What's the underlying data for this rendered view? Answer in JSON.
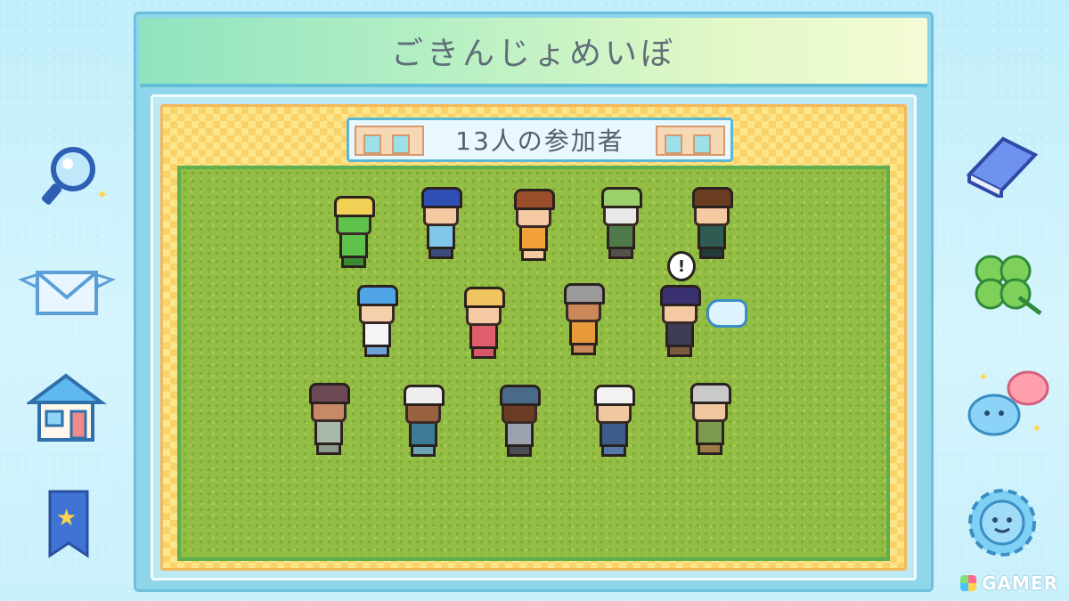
{
  "title": "ごきんじょめいぼ",
  "banner": {
    "label": "13人の参加者"
  },
  "left_menu": [
    {
      "icon": "magnifier-icon"
    },
    {
      "icon": "winged-envelope-icon"
    },
    {
      "icon": "house-icon"
    },
    {
      "icon": "star-bookmark-icon"
    }
  ],
  "right_menu": [
    {
      "icon": "book-icon"
    },
    {
      "icon": "clover-icon"
    },
    {
      "icon": "slime-faces-icon"
    },
    {
      "icon": "sun-face-icon"
    }
  ],
  "speech_bubble": "!",
  "watermark": "GAMER",
  "colors": {
    "accent": "#8fe3bf",
    "frame": "#6cc0db",
    "grass": "#93bd44",
    "check": "#fde58a"
  },
  "participants": [
    {
      "hair": "#f2cf55",
      "skin": "#5fc24d",
      "shirt": "#5fc24d",
      "legs": "#3d8a34"
    },
    {
      "hair": "#2f4fb4",
      "skin": "#f5c9a1",
      "shirt": "#7fc6e8",
      "legs": "#3b4b7c"
    },
    {
      "hair": "#9a4f2a",
      "skin": "#f5c9a1",
      "shirt": "#f3a23a",
      "legs": "#f5c9a1"
    },
    {
      "hair": "#9bd06a",
      "skin": "#e8e8e8",
      "shirt": "#4e7a4a",
      "legs": "#54514f"
    },
    {
      "hair": "#6a3c22",
      "skin": "#f5c9a1",
      "shirt": "#2f5b52",
      "legs": "#243a3b"
    },
    {
      "hair": "#4fa5e6",
      "skin": "#f5d0ad",
      "shirt": "#f4f4f4",
      "legs": "#6ea3d8"
    },
    {
      "hair": "#f1c45f",
      "skin": "#f5c9a1",
      "shirt": "#e05e6b",
      "legs": "#d8566a"
    },
    {
      "hair": "#9a9a9a",
      "skin": "#c9875a",
      "shirt": "#e89a3b",
      "legs": "#c9875a"
    },
    {
      "hair": "#3a3170",
      "skin": "#f5c9a1",
      "shirt": "#3e3d56",
      "legs": "#7b5a3e"
    },
    {
      "hair": "#6b4a55",
      "skin": "#c88a66",
      "shirt": "#a7b8a9",
      "legs": "#8a9a8c"
    },
    {
      "hair": "#eeeeee",
      "skin": "#9a6240",
      "shirt": "#3c7b94",
      "legs": "#6aa5b5"
    },
    {
      "hair": "#4a6a8a",
      "skin": "#6a3c24",
      "shirt": "#9aa2ad",
      "legs": "#4c4c55"
    },
    {
      "hair": "#f2f2f2",
      "skin": "#f0c8a0",
      "shirt": "#3d5c8a",
      "legs": "#5578a8"
    },
    {
      "hair": "#c9c9c9",
      "skin": "#f0c8a0",
      "shirt": "#7a9a4e",
      "legs": "#9b7c46"
    }
  ]
}
